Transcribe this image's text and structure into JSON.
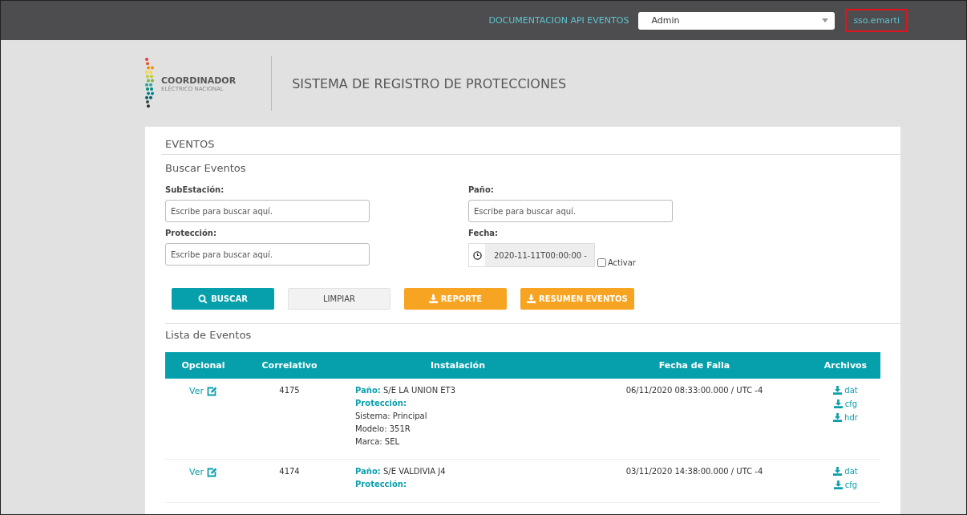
{
  "topbar": {
    "doc_link": "DOCUMENTACION API EVENTOS",
    "role_select": {
      "value": "Admin"
    },
    "user": {
      "label": "sso.emarti",
      "highlighted": true
    }
  },
  "header": {
    "logo": {
      "name": "COORDINADOR",
      "subtitle": "ELÉCTRICO NACIONAL"
    },
    "title": "SISTEMA DE REGISTRO DE PROTECCIONES"
  },
  "section_title": "EVENTOS",
  "search": {
    "title": "Buscar Eventos",
    "fields": [
      {
        "kind": "text",
        "label": "SubEstación:",
        "placeholder": "Escribe para buscar aquí."
      },
      {
        "kind": "text",
        "label": "Paño:",
        "placeholder": "Escribe para buscar aquí."
      },
      {
        "kind": "text",
        "label": "Protección:",
        "placeholder": "Escribe para buscar aquí."
      },
      {
        "kind": "date",
        "label": "Fecha:",
        "value": "2020-11-11T00:00:00 -",
        "checkbox": {
          "label": "Activar",
          "checked": false
        }
      }
    ],
    "buttons": [
      {
        "kind": "primary",
        "label": "BUSCAR"
      },
      {
        "kind": "plain",
        "label": "LIMPIAR"
      },
      {
        "kind": "warning",
        "label": "REPORTE"
      },
      {
        "kind": "warning",
        "label": "RESUMEN EVENTOS"
      }
    ]
  },
  "list": {
    "title": "Lista de Eventos",
    "columns": [
      "Opcional",
      "Correlativo",
      "Instalación",
      "Fecha de Falla",
      "Archivos"
    ],
    "rows": [
      {
        "action": "Ver",
        "id": "4175",
        "pano_label": "Paño:",
        "pano": "S/E LA UNION ET3",
        "proteccion_label": "Protección:",
        "details": [
          "Sistema: Principal",
          "Modelo: 351R",
          "Marca: SEL"
        ],
        "fecha": "06/11/2020 08:33:00.000 / UTC -4",
        "files": [
          "dat",
          "cfg",
          "hdr"
        ]
      },
      {
        "action": "Ver",
        "id": "4174",
        "pano_label": "Paño:",
        "pano": "S/E VALDIVIA J4",
        "proteccion_label": "Protección:",
        "details": [],
        "fecha": "03/11/2020 14:38:00.000 / UTC -4",
        "files": [
          "dat",
          "cfg"
        ]
      }
    ]
  }
}
